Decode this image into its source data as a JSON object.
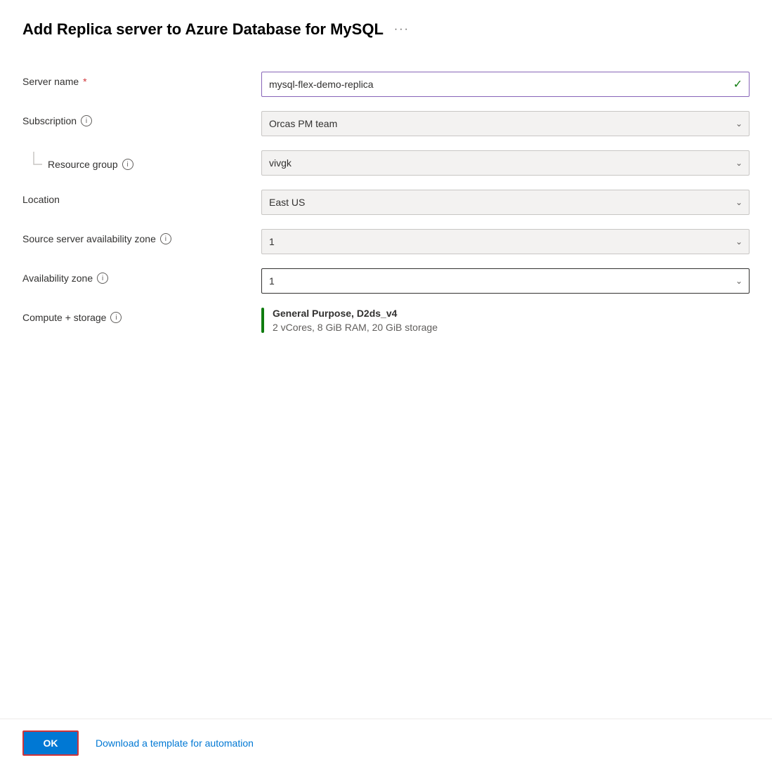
{
  "page": {
    "title": "Add Replica server to Azure Database for MySQL",
    "ellipsis_label": "···"
  },
  "form": {
    "server_name": {
      "label": "Server name",
      "required": true,
      "value": "mysql-flex-demo-replica",
      "checkmark": "✓"
    },
    "subscription": {
      "label": "Subscription",
      "info": "i",
      "value": "Orcas PM team",
      "placeholder": "Orcas PM team"
    },
    "resource_group": {
      "label": "Resource group",
      "info": "i",
      "value": "vivgk",
      "placeholder": "vivgk"
    },
    "location": {
      "label": "Location",
      "value": "East US",
      "placeholder": "East US"
    },
    "source_availability_zone": {
      "label": "Source server availability zone",
      "info": "i",
      "value": "1",
      "placeholder": "1"
    },
    "availability_zone": {
      "label": "Availability zone",
      "info": "i",
      "value": "1",
      "placeholder": "1"
    },
    "compute_storage": {
      "label": "Compute + storage",
      "info": "i",
      "tier_label": "General Purpose, D2ds_v4",
      "details_label": "2 vCores, 8 GiB RAM, 20 GiB storage"
    }
  },
  "footer": {
    "ok_button_label": "OK",
    "template_link_label": "Download a template for automation"
  },
  "icons": {
    "chevron": "∨",
    "checkmark": "✓",
    "info": "i",
    "ellipsis": "···"
  }
}
